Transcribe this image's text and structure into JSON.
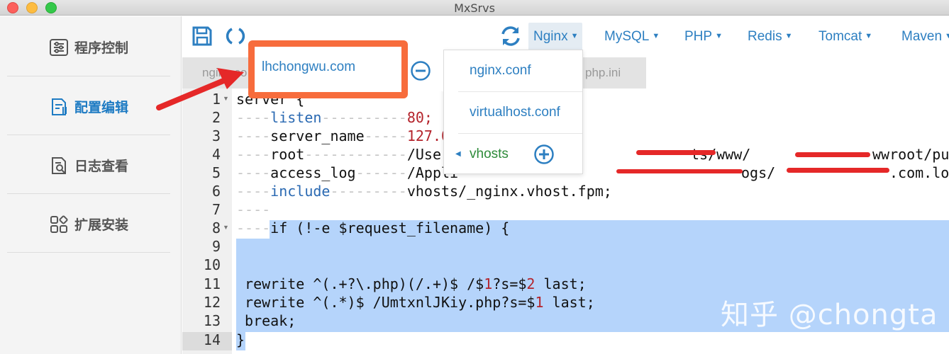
{
  "window": {
    "title": "MxSrvs"
  },
  "sidebar": {
    "items": [
      {
        "label": "程序控制",
        "icon": "sliders-icon",
        "active": false
      },
      {
        "label": "配置编辑",
        "icon": "config-edit-icon",
        "active": true
      },
      {
        "label": "日志查看",
        "icon": "log-view-icon",
        "active": false
      },
      {
        "label": "扩展安装",
        "icon": "extensions-icon",
        "active": false
      }
    ]
  },
  "toolbar": {
    "icons": [
      "save-icon",
      "reload-icon",
      "refresh-icon"
    ],
    "menus": [
      {
        "label": "Nginx",
        "active": true
      },
      {
        "label": "MySQL"
      },
      {
        "label": "PHP"
      },
      {
        "label": "Redis"
      },
      {
        "label": "Tomcat"
      },
      {
        "label": "Maven"
      }
    ]
  },
  "tabs": [
    "nginx.co",
    "php.ini"
  ],
  "dropdown": {
    "items": [
      "nginx.conf",
      "virtualhost.conf",
      "vhosts"
    ],
    "submenu": {
      "item": "lhchongwu.com"
    }
  },
  "editor": {
    "line_numbers": [
      "1",
      "2",
      "3",
      "4",
      "5",
      "6",
      "7",
      "8",
      "9",
      "10",
      "11",
      "12",
      "13",
      "14"
    ],
    "lines": {
      "l1": "server {",
      "l2_kw": "listen",
      "l2_val": "80;",
      "l3_kw": "server_name",
      "l3_val": "127.0",
      "l4_kw": "root",
      "l4_a": "/User",
      "l4_b": "ts/www/",
      "l4_c": "wwroot/public;",
      "l5_kw": "access_log",
      "l5_a": "/Appli",
      "l5_b": "ogs/",
      "l5_c": ".com.log;",
      "l6_kw": "include",
      "l6_val": "vhosts/_nginx.vhost.fpm;",
      "l8": "if (!-e $request_filename) {",
      "l11_a": " rewrite ^(.+?\\.php)(/.+)$ /$",
      "l11_n1": "1",
      "l11_b": "?s=$",
      "l11_n2": "2",
      "l11_c": " last;",
      "l12_a": " rewrite ^(.*)$ /UmtxnlJKiy.php?s=$",
      "l12_n1": "1",
      "l12_c": " last;",
      "l13": " break;",
      "l14": "}"
    }
  },
  "watermark": "知乎 @chongta",
  "colors": {
    "accent": "#2d7fc1",
    "selection": "#b5d4fb",
    "highlight_box": "#f76c3c",
    "annotation": "#e52828"
  }
}
